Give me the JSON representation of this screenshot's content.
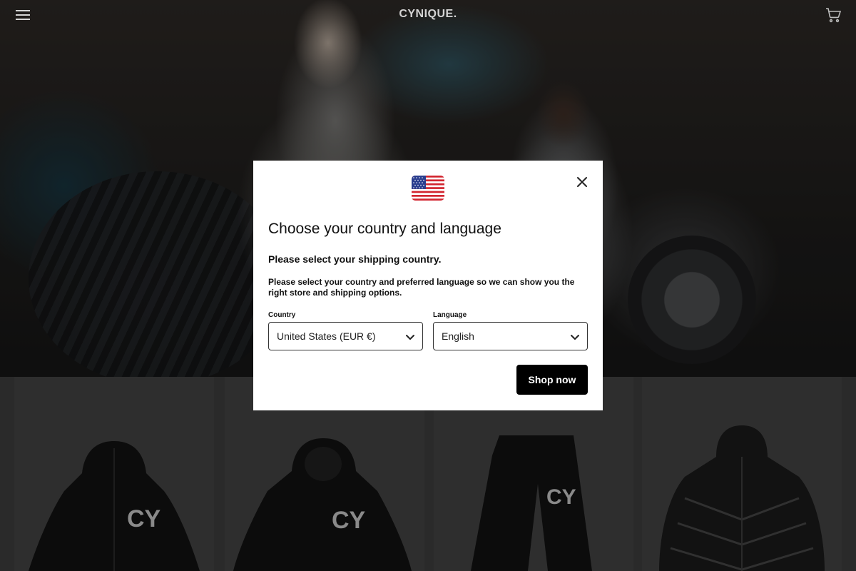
{
  "header": {
    "brand": "CYNIQUE.",
    "menu_icon": "hamburger-menu-icon",
    "cart_icon": "shopping-cart-icon"
  },
  "hero": {
    "image_name": "hero-image"
  },
  "modal": {
    "flag_icon": "us-flag-icon",
    "close_icon": "close-icon",
    "title": "Choose your country and language",
    "subtitle": "Please select your shipping country.",
    "description": "Please select your country and preferred language so we can show you the right store and shipping options.",
    "country_label": "Country",
    "country_value": "United States (EUR €)",
    "language_label": "Language",
    "language_value": "English",
    "shop_button": "Shop now"
  },
  "products": [
    {
      "name": "zip-hoodie"
    },
    {
      "name": "pullover-hoodie"
    },
    {
      "name": "sweatpants"
    },
    {
      "name": "puffer-jacket"
    }
  ],
  "colors": {
    "overlay": "#000000",
    "modal_bg": "#ffffff",
    "button_bg": "#000000",
    "brand_text": "#d4d4d4"
  }
}
